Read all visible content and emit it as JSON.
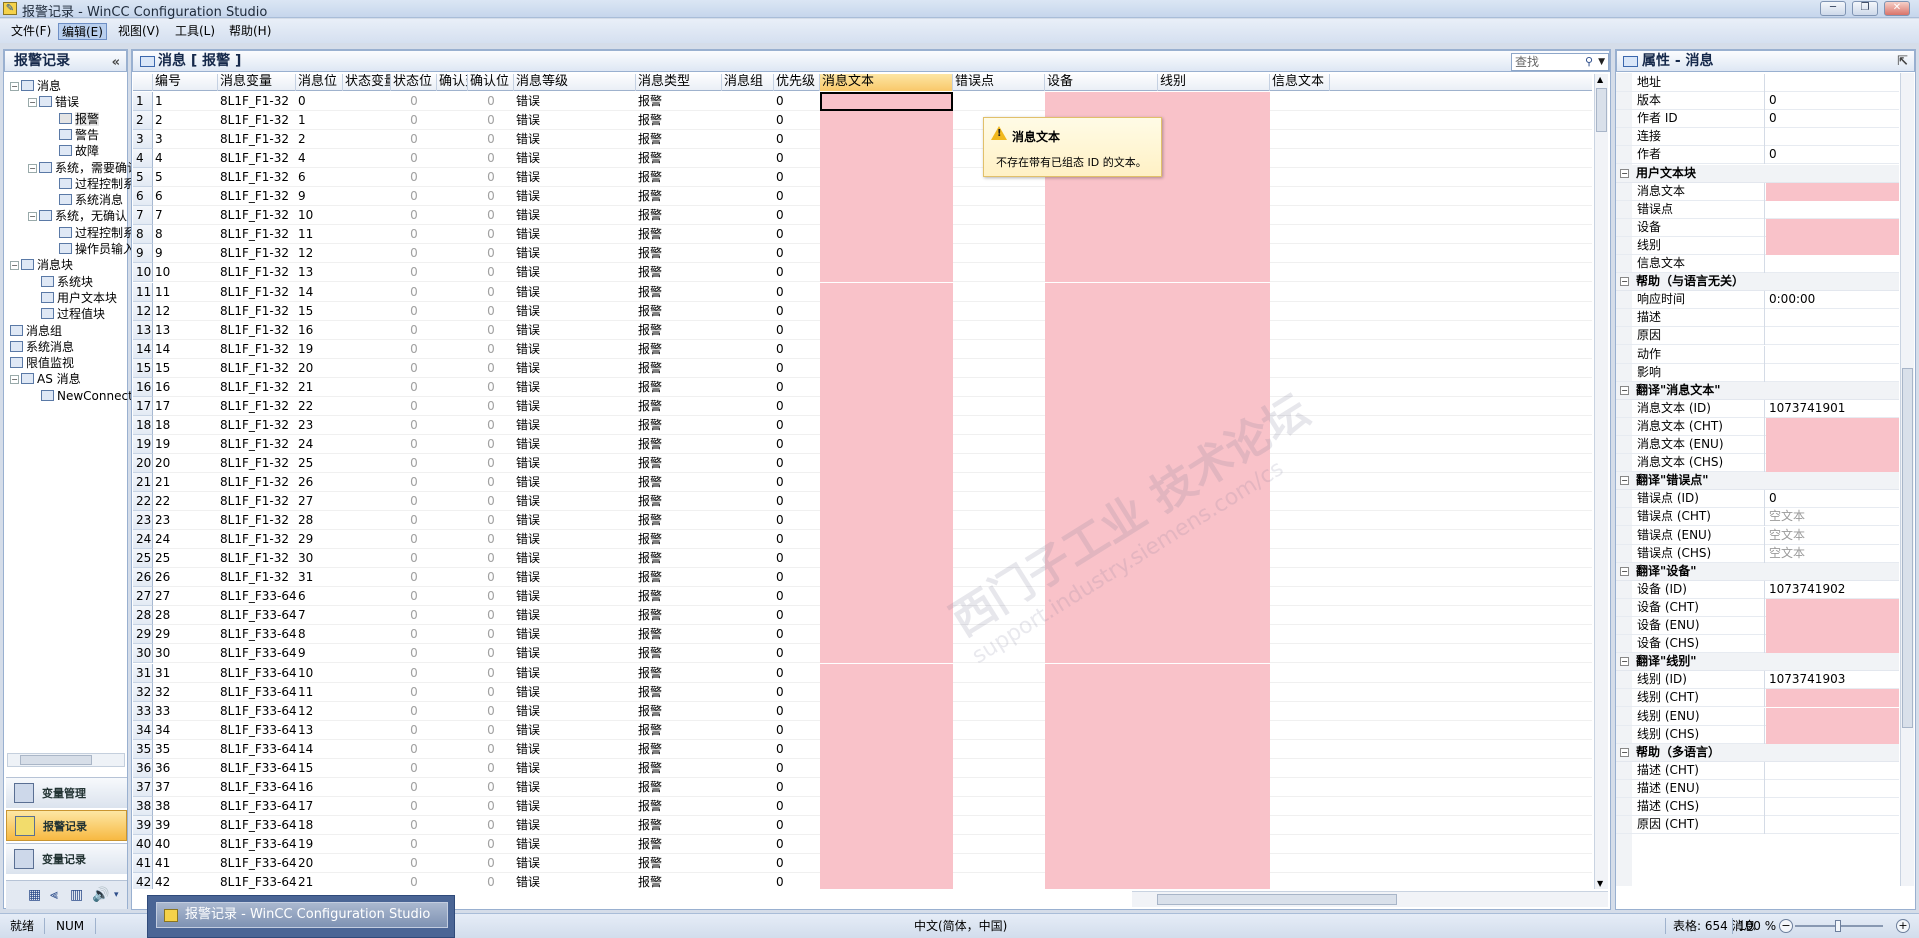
{
  "window": {
    "title": "报警记录 - WinCC Configuration Studio",
    "buttons": [
      "─",
      "❐",
      "✕"
    ]
  },
  "menu": [
    {
      "label": "文件(F)"
    },
    {
      "label": "编辑(E)",
      "active": true
    },
    {
      "label": "视图(V)"
    },
    {
      "label": "工具(L)"
    },
    {
      "label": "帮助(H)"
    }
  ],
  "left_panel": {
    "title": "报警记录",
    "collapse": "«",
    "tree": [
      {
        "label": "消息",
        "level": 0,
        "exp": "−"
      },
      {
        "label": "错误",
        "level": 1,
        "exp": "−"
      },
      {
        "label": "报警",
        "level": 2,
        "selected": true
      },
      {
        "label": "警告",
        "level": 2
      },
      {
        "label": "故障",
        "level": 2
      },
      {
        "label": "系统，需要确认",
        "level": 1,
        "exp": "−"
      },
      {
        "label": "过程控制系统",
        "level": 2
      },
      {
        "label": "系统消息",
        "level": 2
      },
      {
        "label": "系统，无确认",
        "level": 1,
        "exp": "−"
      },
      {
        "label": "过程控制系统",
        "level": 2
      },
      {
        "label": "操作员输入",
        "level": 2
      },
      {
        "label": "消息块",
        "level": 0,
        "exp": "−"
      },
      {
        "label": "系统块",
        "level": 1
      },
      {
        "label": "用户文本块",
        "level": 1
      },
      {
        "label": "过程值块",
        "level": 1
      },
      {
        "label": "消息组",
        "level": 0
      },
      {
        "label": "系统消息",
        "level": 0
      },
      {
        "label": "限值监视",
        "level": 0
      },
      {
        "label": "AS 消息",
        "level": 0,
        "exp": "−"
      },
      {
        "label": "NewConnection",
        "level": 1
      }
    ],
    "nav_buttons": [
      {
        "label": "变量管理"
      },
      {
        "label": "报警记录",
        "active": true
      },
      {
        "label": "变量记录"
      }
    ],
    "bottom_icons": [
      "▦",
      "⫷",
      "▥",
      "🔊",
      "▾"
    ]
  },
  "main": {
    "title": "消息 [ 报警 ]",
    "search_placeholder": "查找",
    "columns": [
      "",
      "编号",
      "消息变量",
      "消息位",
      "状态变量",
      "状态位",
      "确认变量",
      "确认位",
      "消息等级",
      "消息类型",
      "消息组",
      "优先级",
      "消息文本",
      "错误点",
      "设备",
      "线别",
      "信息文本"
    ],
    "selected_column": "消息文本",
    "default": {
      "class": "错误",
      "type": "报警",
      "status_bit": "0",
      "ack_bit": "0",
      "priority": "0"
    },
    "rows": [
      {
        "n": 1,
        "var": "8L1F_F1-32",
        "bit": 0
      },
      {
        "n": 2,
        "var": "8L1F_F1-32",
        "bit": 1
      },
      {
        "n": 3,
        "var": "8L1F_F1-32",
        "bit": 2
      },
      {
        "n": 4,
        "var": "8L1F_F1-32",
        "bit": 4
      },
      {
        "n": 5,
        "var": "8L1F_F1-32",
        "bit": 6
      },
      {
        "n": 6,
        "var": "8L1F_F1-32",
        "bit": 9
      },
      {
        "n": 7,
        "var": "8L1F_F1-32",
        "bit": 10
      },
      {
        "n": 8,
        "var": "8L1F_F1-32",
        "bit": 11
      },
      {
        "n": 9,
        "var": "8L1F_F1-32",
        "bit": 12
      },
      {
        "n": 10,
        "var": "8L1F_F1-32",
        "bit": 13
      },
      {
        "n": 11,
        "var": "8L1F_F1-32",
        "bit": 14
      },
      {
        "n": 12,
        "var": "8L1F_F1-32",
        "bit": 15
      },
      {
        "n": 13,
        "var": "8L1F_F1-32",
        "bit": 16
      },
      {
        "n": 14,
        "var": "8L1F_F1-32",
        "bit": 19
      },
      {
        "n": 15,
        "var": "8L1F_F1-32",
        "bit": 20
      },
      {
        "n": 16,
        "var": "8L1F_F1-32",
        "bit": 21
      },
      {
        "n": 17,
        "var": "8L1F_F1-32",
        "bit": 22
      },
      {
        "n": 18,
        "var": "8L1F_F1-32",
        "bit": 23
      },
      {
        "n": 19,
        "var": "8L1F_F1-32",
        "bit": 24
      },
      {
        "n": 20,
        "var": "8L1F_F1-32",
        "bit": 25
      },
      {
        "n": 21,
        "var": "8L1F_F1-32",
        "bit": 26
      },
      {
        "n": 22,
        "var": "8L1F_F1-32",
        "bit": 27
      },
      {
        "n": 23,
        "var": "8L1F_F1-32",
        "bit": 28
      },
      {
        "n": 24,
        "var": "8L1F_F1-32",
        "bit": 29
      },
      {
        "n": 25,
        "var": "8L1F_F1-32",
        "bit": 30
      },
      {
        "n": 26,
        "var": "8L1F_F1-32",
        "bit": 31
      },
      {
        "n": 27,
        "var": "8L1F_F33-64",
        "bit": 6
      },
      {
        "n": 28,
        "var": "8L1F_F33-64",
        "bit": 7
      },
      {
        "n": 29,
        "var": "8L1F_F33-64",
        "bit": 8
      },
      {
        "n": 30,
        "var": "8L1F_F33-64",
        "bit": 9
      },
      {
        "n": 31,
        "var": "8L1F_F33-64",
        "bit": 10
      },
      {
        "n": 32,
        "var": "8L1F_F33-64",
        "bit": 11
      },
      {
        "n": 33,
        "var": "8L1F_F33-64",
        "bit": 12
      },
      {
        "n": 34,
        "var": "8L1F_F33-64",
        "bit": 13
      },
      {
        "n": 35,
        "var": "8L1F_F33-64",
        "bit": 14
      },
      {
        "n": 36,
        "var": "8L1F_F33-64",
        "bit": 15
      },
      {
        "n": 37,
        "var": "8L1F_F33-64",
        "bit": 16
      },
      {
        "n": 38,
        "var": "8L1F_F33-64",
        "bit": 17
      },
      {
        "n": 39,
        "var": "8L1F_F33-64",
        "bit": 18
      },
      {
        "n": 40,
        "var": "8L1F_F33-64",
        "bit": 19
      },
      {
        "n": 41,
        "var": "8L1F_F33-64",
        "bit": 20
      },
      {
        "n": 42,
        "var": "8L1F_F33-64",
        "bit": 21
      }
    ],
    "tooltip": {
      "title": "消息文本",
      "text": "不存在带有已组态 ID 的文本。"
    },
    "watermark": "西门子工业 技术论坛",
    "watermark_url": "support.industry.siemens.com/cs"
  },
  "right_panel": {
    "title": "属性 - 消息",
    "pin": "⇱",
    "items": [
      {
        "label": "地址",
        "value": ""
      },
      {
        "label": "版本",
        "value": "0"
      },
      {
        "label": "作者 ID",
        "value": "0"
      },
      {
        "label": "连接",
        "value": ""
      },
      {
        "label": "作者",
        "value": "0"
      },
      {
        "cat": "用户文本块"
      },
      {
        "label": "消息文本",
        "value": "",
        "pink": true
      },
      {
        "label": "错误点",
        "value": ""
      },
      {
        "label": "设备",
        "value": "",
        "pink": true
      },
      {
        "label": "线别",
        "value": "",
        "pink": true
      },
      {
        "label": "信息文本",
        "value": ""
      },
      {
        "cat": "帮助（与语言无关）"
      },
      {
        "label": "响应时间",
        "value": "0:00:00"
      },
      {
        "label": "描述",
        "value": ""
      },
      {
        "label": "原因",
        "value": ""
      },
      {
        "label": "动作",
        "value": ""
      },
      {
        "label": "影响",
        "value": ""
      },
      {
        "cat": "翻译\"消息文本\""
      },
      {
        "label": "消息文本 (ID)",
        "value": "1073741901"
      },
      {
        "label": "消息文本 (CHT)",
        "value": "",
        "pink": true
      },
      {
        "label": "消息文本 (ENU)",
        "value": "",
        "pink": true
      },
      {
        "label": "消息文本 (CHS)",
        "value": "",
        "pink": true
      },
      {
        "cat": "翻译\"错误点\""
      },
      {
        "label": "错误点 (ID)",
        "value": "0"
      },
      {
        "label": "错误点 (CHT)",
        "value": "空文本",
        "gray": true
      },
      {
        "label": "错误点 (ENU)",
        "value": "空文本",
        "gray": true
      },
      {
        "label": "错误点 (CHS)",
        "value": "空文本",
        "gray": true
      },
      {
        "cat": "翻译\"设备\""
      },
      {
        "label": "设备 (ID)",
        "value": "1073741902"
      },
      {
        "label": "设备 (CHT)",
        "value": "",
        "pink": true
      },
      {
        "label": "设备 (ENU)",
        "value": "",
        "pink": true
      },
      {
        "label": "设备 (CHS)",
        "value": "",
        "pink": true
      },
      {
        "cat": "翻译\"线别\""
      },
      {
        "label": "线别 (ID)",
        "value": "1073741903"
      },
      {
        "label": "线别 (CHT)",
        "value": "",
        "pink": true
      },
      {
        "label": "线别 (ENU)",
        "value": "",
        "pink": true
      },
      {
        "label": "线别 (CHS)",
        "value": "",
        "pink": true
      },
      {
        "cat": "帮助（多语言）"
      },
      {
        "label": "描述 (CHT)",
        "value": ""
      },
      {
        "label": "描述 (ENU)",
        "value": ""
      },
      {
        "label": "描述 (CHS)",
        "value": ""
      },
      {
        "label": "原因 (CHT)",
        "value": ""
      }
    ]
  },
  "status": {
    "ready": "就绪",
    "num": "NUM",
    "language": "中文(简体，中国)",
    "count": "表格: 654 消息",
    "zoom": "100 %"
  },
  "taskbar_preview": "报警记录 - WinCC Configuration Studio",
  "colors": {
    "pink": "#f9c2c9",
    "selected_header": "#f9c86a",
    "nav_active": "#f7b942"
  }
}
